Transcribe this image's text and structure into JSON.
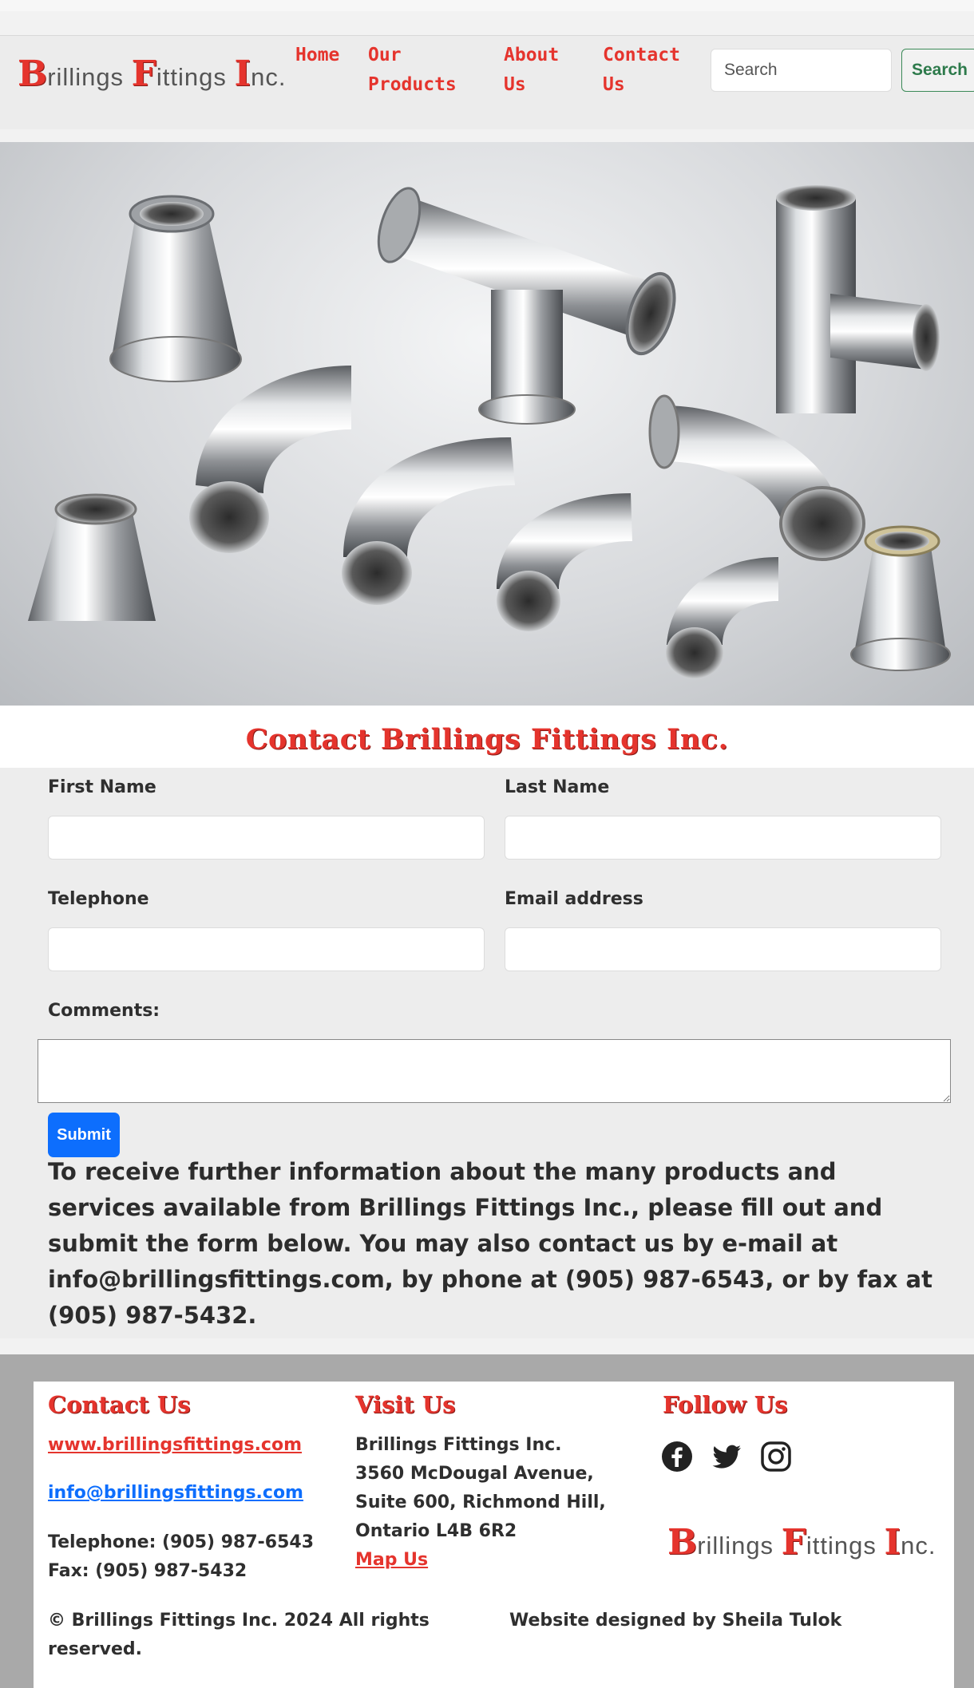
{
  "brand": {
    "logo_parts": [
      {
        "cap": "B",
        "rest": "rillings "
      },
      {
        "cap": "F",
        "rest": "ittings "
      },
      {
        "cap": "I",
        "rest": "nc."
      }
    ]
  },
  "nav": {
    "items": [
      {
        "label": "Home"
      },
      {
        "label": "Our Products"
      },
      {
        "label": "About Us"
      },
      {
        "label": "Contact Us"
      }
    ]
  },
  "search": {
    "placeholder": "Search",
    "button_label": "Search"
  },
  "contact_section": {
    "title": "Contact Brillings Fittings Inc.",
    "labels": {
      "first_name": "First Name",
      "last_name": "Last Name",
      "telephone": "Telephone",
      "email": "Email address",
      "comments": "Comments:"
    },
    "submit_label": "Submit",
    "info_text": "To receive further information about the many products and services available from Brillings Fittings Inc., please fill out and submit the form below. You may also contact us by e-mail at info@brillingsfittings.com, by phone at (905) 987-6543, or by fax at (905) 987-5432."
  },
  "footer": {
    "contact": {
      "heading": "Contact Us",
      "website": "www.brillingsfittings.com",
      "email": "info@brillingsfittings.com",
      "telephone": "Telephone: (905) 987-6543",
      "fax": "Fax: (905) 987-5432"
    },
    "visit": {
      "heading": "Visit Us",
      "address_lines": [
        "Brillings Fittings Inc.",
        "3560 McDougal Avenue,",
        "Suite 600, Richmond Hill,",
        "Ontario L4B 6R2"
      ],
      "map_link": "Map Us"
    },
    "follow": {
      "heading": "Follow Us",
      "icons": [
        "facebook-icon",
        "twitter-icon",
        "instagram-icon"
      ]
    },
    "copyright": "© Brillings Fittings Inc. 2024 All rights reserved.",
    "designer": "Website designed by Sheila Tulok"
  },
  "colors": {
    "brand_red": "#e5342d",
    "link_blue": "#0d6efd",
    "search_green": "#2d7a4b"
  }
}
